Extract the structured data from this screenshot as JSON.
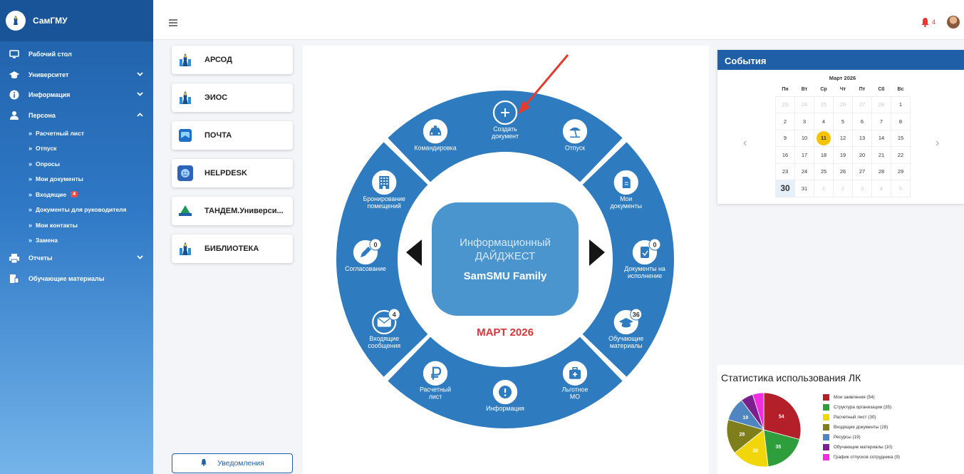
{
  "app": {
    "title": "СамГМУ"
  },
  "sidebar": {
    "items": [
      {
        "label": "Рабочий стол",
        "icon": "desktop-icon"
      },
      {
        "label": "Университет",
        "icon": "graduation-cap-icon",
        "chevron": "down"
      },
      {
        "label": "Информация",
        "icon": "info-icon",
        "chevron": "down"
      },
      {
        "label": "Персона",
        "icon": "user-icon",
        "chevron": "up"
      }
    ],
    "subitems": [
      {
        "label": "Расчетный лист"
      },
      {
        "label": "Отпуск"
      },
      {
        "label": "Опросы"
      },
      {
        "label": "Мои документы"
      },
      {
        "label": "Входящие",
        "badge": "4"
      },
      {
        "label": "Документы для руководителя"
      },
      {
        "label": "Мои контакты"
      },
      {
        "label": "Замена"
      }
    ],
    "bottom_items": [
      {
        "label": "Отчеты",
        "icon": "printer-icon",
        "chevron": "down"
      },
      {
        "label": "Обучающие материалы",
        "icon": "materials-icon"
      }
    ]
  },
  "topbar": {
    "notifications_count": "4"
  },
  "apps": [
    {
      "label": "АРСОД",
      "icon": "samgmu-logo-icon"
    },
    {
      "label": "ЭИОС",
      "icon": "samgmu-logo-icon"
    },
    {
      "label": "ПОЧТА",
      "icon": "mail-app-icon"
    },
    {
      "label": "HELPDESK",
      "icon": "helpdesk-icon"
    },
    {
      "label": "ТАНДЕМ.Универси...",
      "icon": "tandem-icon"
    },
    {
      "label": "БИБЛИОТЕКА",
      "icon": "samgmu-logo-icon"
    }
  ],
  "notifications_button": {
    "label": "Уведомления"
  },
  "wheel": {
    "center_line1": "Информационный",
    "center_line2": "ДАЙДЖЕСТ",
    "center_line3": "SamSMU Family",
    "date_label": "МАРТ 2026",
    "items": [
      {
        "label1": "Создать",
        "label2": "документ",
        "icon": "plus-icon"
      },
      {
        "label1": "Отпуск",
        "label2": "",
        "icon": "beach-umbrella-icon"
      },
      {
        "label1": "Мои",
        "label2": "документы",
        "icon": "document-icon"
      },
      {
        "label1": "Документы на",
        "label2": "исполнение",
        "icon": "doc-exec-icon",
        "badge": "0"
      },
      {
        "label1": "Обучающие",
        "label2": "материалы",
        "icon": "graduation-cap-icon",
        "badge": "36"
      },
      {
        "label1": "Льготное",
        "label2": "МО",
        "icon": "medical-kit-icon"
      },
      {
        "label1": "Информация",
        "label2": "",
        "icon": "exclamation-icon"
      },
      {
        "label1": "Расчетный",
        "label2": "лист",
        "icon": "ruble-icon"
      },
      {
        "label1": "Входящие",
        "label2": "сообщения",
        "icon": "envelope-icon",
        "badge": "4"
      },
      {
        "label1": "Согласование",
        "label2": "",
        "icon": "pen-icon",
        "badge": "0"
      },
      {
        "label1": "Бронирование",
        "label2": "помещений",
        "icon": "building-icon"
      },
      {
        "label1": "Командировка",
        "label2": "",
        "icon": "taxi-icon"
      }
    ]
  },
  "events": {
    "title": "События",
    "month": "Март 2026",
    "weekdays": [
      "Пн",
      "Вт",
      "Ср",
      "Чт",
      "Пт",
      "Сб",
      "Вс"
    ],
    "weeks": [
      [
        {
          "d": "23",
          "m": 1
        },
        {
          "d": "24",
          "m": 1
        },
        {
          "d": "25",
          "m": 1
        },
        {
          "d": "26",
          "m": 1
        },
        {
          "d": "27",
          "m": 1
        },
        {
          "d": "28",
          "m": 1
        },
        {
          "d": "1",
          "m": 0
        }
      ],
      [
        {
          "d": "2",
          "m": 0
        },
        {
          "d": "3",
          "m": 0
        },
        {
          "d": "4",
          "m": 0
        },
        {
          "d": "5",
          "m": 0
        },
        {
          "d": "6",
          "m": 0
        },
        {
          "d": "7",
          "m": 0
        },
        {
          "d": "8",
          "m": 0
        }
      ],
      [
        {
          "d": "9",
          "m": 0
        },
        {
          "d": "10",
          "m": 0
        },
        {
          "d": "11",
          "m": 0,
          "t": 1
        },
        {
          "d": "12",
          "m": 0
        },
        {
          "d": "13",
          "m": 0
        },
        {
          "d": "14",
          "m": 0
        },
        {
          "d": "15",
          "m": 0
        }
      ],
      [
        {
          "d": "16",
          "m": 0
        },
        {
          "d": "17",
          "m": 0
        },
        {
          "d": "18",
          "m": 0
        },
        {
          "d": "19",
          "m": 0
        },
        {
          "d": "20",
          "m": 0
        },
        {
          "d": "21",
          "m": 0
        },
        {
          "d": "22",
          "m": 0
        }
      ],
      [
        {
          "d": "23",
          "m": 0
        },
        {
          "d": "24",
          "m": 0
        },
        {
          "d": "25",
          "m": 0
        },
        {
          "d": "26",
          "m": 0
        },
        {
          "d": "27",
          "m": 0
        },
        {
          "d": "28",
          "m": 0
        },
        {
          "d": "29",
          "m": 0
        }
      ],
      [
        {
          "d": "30",
          "m": 0,
          "s": 1
        },
        {
          "d": "31",
          "m": 0
        },
        {
          "d": "1",
          "m": 1
        },
        {
          "d": "2",
          "m": 1
        },
        {
          "d": "3",
          "m": 1
        },
        {
          "d": "4",
          "m": 1
        },
        {
          "d": "5",
          "m": 1
        }
      ]
    ]
  },
  "stats": {
    "title": "Статистика использования ЛК"
  },
  "chart_data": {
    "type": "pie",
    "title": "Статистика использования ЛК",
    "categories": [
      "Мои заявления (54)",
      "Структура организации (35)",
      "Расчетный лист (30)",
      "Входящие документы (28)",
      "Ресурсы (19)",
      "Обучающие материалы (10)",
      "График отпусков сотрудника (9)"
    ],
    "values": [
      54,
      35,
      30,
      28,
      19,
      10,
      9
    ],
    "colors": [
      "#b3202a",
      "#2e9e3c",
      "#f2d60c",
      "#7e7e1a",
      "#4f86c2",
      "#7b1f8e",
      "#f02ee0"
    ],
    "legend": "right"
  },
  "colors": {
    "primary": "#1f5fa8",
    "wheel": "#2f7bc0",
    "accent_red": "#d8343a"
  }
}
